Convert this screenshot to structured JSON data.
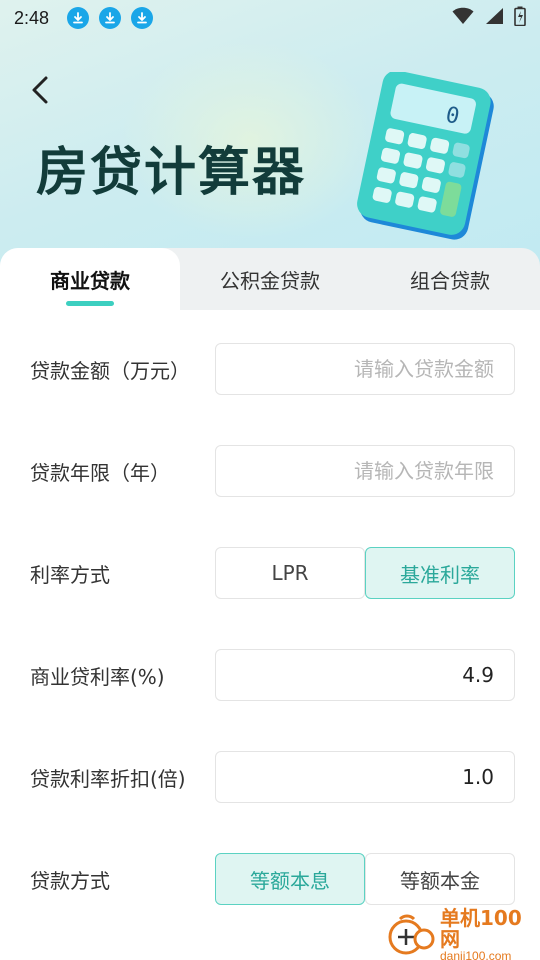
{
  "status_bar": {
    "time": "2:48"
  },
  "header": {
    "title": "房贷计算器"
  },
  "tabs": [
    {
      "label": "商业贷款",
      "active": true
    },
    {
      "label": "公积金贷款",
      "active": false
    },
    {
      "label": "组合贷款",
      "active": false
    }
  ],
  "form": {
    "loan_amount": {
      "label": "贷款金额（万元）",
      "placeholder": "请输入贷款金额",
      "value": ""
    },
    "loan_years": {
      "label": "贷款年限（年）",
      "placeholder": "请输入贷款年限",
      "value": ""
    },
    "rate_method": {
      "label": "利率方式",
      "options": [
        "LPR",
        "基准利率"
      ],
      "selected": "基准利率"
    },
    "commercial_rate": {
      "label": "商业贷利率(%)",
      "value": "4.9"
    },
    "rate_discount": {
      "label": "贷款利率折扣(倍)",
      "value": "1.0"
    },
    "repay_method": {
      "label": "贷款方式",
      "options": [
        "等额本息",
        "等额本金"
      ],
      "selected": "等额本息"
    }
  },
  "watermark": {
    "name": "单机100网",
    "url": "danji100.com"
  },
  "colors": {
    "accent": "#3ccfc0",
    "selected_bg": "#dff5f2",
    "title": "#123c3a",
    "status_blue": "#1aa6e8"
  }
}
